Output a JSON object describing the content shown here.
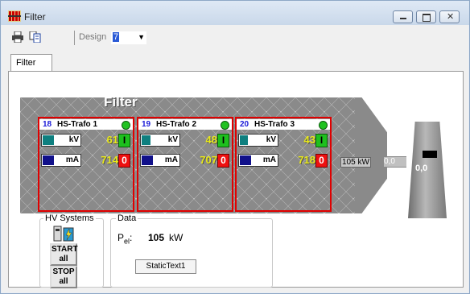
{
  "window": {
    "title": "Filter"
  },
  "toolbar": {
    "design_label": "Design",
    "design_value": "7"
  },
  "tabs": [
    {
      "label": "Filter"
    }
  ],
  "filter": {
    "title": "Filter"
  },
  "trafos": [
    {
      "number": "18",
      "name": "HS-Trafo 1",
      "kv_unit": "kV",
      "kv_value": "61",
      "ma_unit": "mA",
      "ma_value": "714",
      "on_label": "I",
      "off_label": "0",
      "status_color": "#21c221"
    },
    {
      "number": "19",
      "name": "HS-Trafo 2",
      "kv_unit": "kV",
      "kv_value": "48",
      "ma_unit": "mA",
      "ma_value": "707",
      "on_label": "I",
      "off_label": "0",
      "status_color": "#21c221"
    },
    {
      "number": "20",
      "name": "HS-Trafo 3",
      "kv_unit": "kV",
      "kv_value": "43",
      "ma_unit": "mA",
      "ma_value": "718",
      "on_label": "I",
      "off_label": "0",
      "status_color": "#21c221"
    }
  ],
  "total_power": "105 kW",
  "duct_value": "0,0",
  "chimney_value": "0,0",
  "hv_systems": {
    "legend": "HV Systems",
    "start_line1": "START",
    "start_line2": "all",
    "stop_line1": "STOP",
    "stop_line2": "all"
  },
  "data_group": {
    "legend": "Data",
    "pel_label": "P",
    "pel_sub": "el",
    "pel_colon": ":",
    "pel_value": "105",
    "pel_unit": "kW",
    "static_text": "StaticText1"
  },
  "colors": {
    "bar_kv": "#0e7f7f",
    "bar_ma": "#10108a",
    "frame": "#e00000"
  }
}
